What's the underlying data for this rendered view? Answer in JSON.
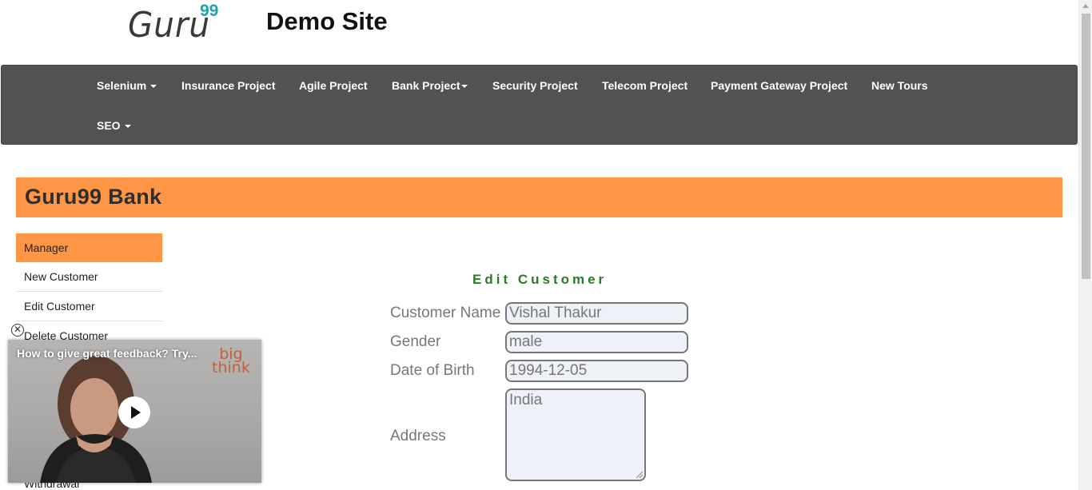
{
  "header": {
    "logo_word": "Guru",
    "logo_sup": "99",
    "site_title": "Demo Site"
  },
  "navbar": {
    "items": [
      {
        "label": "Selenium",
        "dropdown": true
      },
      {
        "label": "Insurance Project",
        "dropdown": false
      },
      {
        "label": "Agile Project",
        "dropdown": false
      },
      {
        "label": "Bank Project",
        "dropdown": true
      },
      {
        "label": "Security Project",
        "dropdown": false
      },
      {
        "label": "Telecom Project",
        "dropdown": false
      },
      {
        "label": "Payment Gateway Project",
        "dropdown": false
      },
      {
        "label": "New Tours",
        "dropdown": false
      },
      {
        "label": "SEO",
        "dropdown": true
      }
    ]
  },
  "bank": {
    "title": "Guru99 Bank"
  },
  "sidebar": {
    "items": [
      {
        "label": "Manager",
        "active": true
      },
      {
        "label": "New Customer",
        "active": false
      },
      {
        "label": "Edit Customer",
        "active": false
      },
      {
        "label": "Delete Customer",
        "active": false
      }
    ],
    "partial_item": "Withdrawal"
  },
  "form": {
    "heading": "Edit Customer",
    "fields": {
      "customer_name": {
        "label": "Customer Name",
        "value": "Vishal Thakur"
      },
      "gender": {
        "label": "Gender",
        "value": "male"
      },
      "dob": {
        "label": "Date of Birth",
        "value": "1994-12-05"
      },
      "address": {
        "label": "Address",
        "value": "India"
      }
    }
  },
  "video": {
    "title": "How to give great feedback? Try...",
    "brand_line1": "big",
    "brand_line2": "think",
    "close_icon": "close-circle-icon",
    "play_icon": "play-icon"
  },
  "colors": {
    "navbar_bg": "#525252",
    "accent_orange": "#ff9645",
    "heading_green": "#2a7a2a",
    "logo_teal": "#1aa3b0"
  }
}
